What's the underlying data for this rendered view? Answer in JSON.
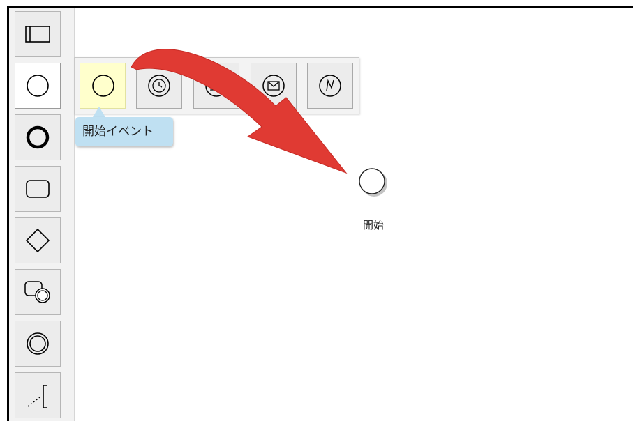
{
  "palette": {
    "tools": [
      {
        "name": "pool"
      },
      {
        "name": "start-event",
        "selected": true
      },
      {
        "name": "end-event"
      },
      {
        "name": "task"
      },
      {
        "name": "gateway"
      },
      {
        "name": "subprocess"
      },
      {
        "name": "intermediate-event"
      },
      {
        "name": "annotation"
      }
    ]
  },
  "popup": {
    "items": [
      {
        "name": "start-event-none",
        "hover": true
      },
      {
        "name": "timer-start-event"
      },
      {
        "name": "signal-start-event"
      },
      {
        "name": "message-start-event"
      },
      {
        "name": "conditional-start-event"
      }
    ],
    "tooltip": "開始イベント"
  },
  "canvas": {
    "start_event_label": "開始"
  },
  "colors": {
    "arrow": "#e03a33",
    "hover_bg": "#ffffcc",
    "tooltip_bg": "#bfe0f2"
  }
}
